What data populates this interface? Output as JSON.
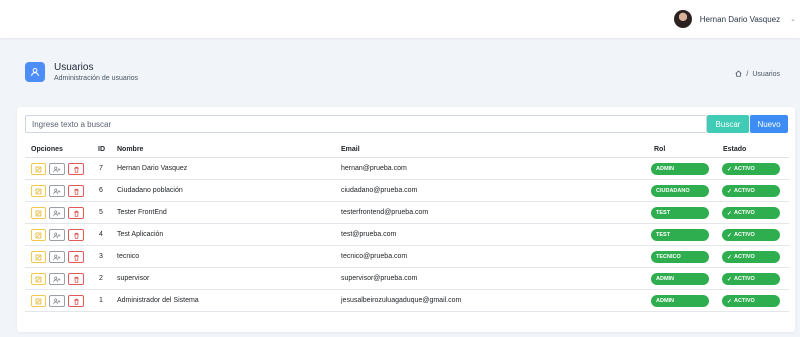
{
  "header": {
    "user_name": "Hernan Dario Vasquez",
    "caret_icon": "chevron-down-icon"
  },
  "page": {
    "title": "Usuarios",
    "subtitle": "Administración de usuarios",
    "breadcrumb_current": "Usuarios"
  },
  "toolbar": {
    "search_placeholder": "Ingrese texto a buscar",
    "search_label": "Buscar",
    "new_label": "Nuevo"
  },
  "table": {
    "columns": [
      "Opciones",
      "ID",
      "Nombre",
      "Email",
      "Rol",
      "Estado"
    ],
    "rows": [
      {
        "id": "7",
        "nombre": "Hernan Dario Vasquez",
        "email": "hernan@prueba.com",
        "rol": "ADMIN",
        "estado": "ACTIVO"
      },
      {
        "id": "6",
        "nombre": "Ciudadano población",
        "email": "ciudadano@prueba.com",
        "rol": "CIUDADANO",
        "estado": "ACTIVO"
      },
      {
        "id": "5",
        "nombre": "Tester FrontEnd",
        "email": "testerfrontend@prueba.com",
        "rol": "TEST",
        "estado": "ACTIVO"
      },
      {
        "id": "4",
        "nombre": "Test Aplicación",
        "email": "test@prueba.com",
        "rol": "TEST",
        "estado": "ACTIVO"
      },
      {
        "id": "3",
        "nombre": "tecnico",
        "email": "tecnico@prueba.com",
        "rol": "TECNICO",
        "estado": "ACTIVO"
      },
      {
        "id": "2",
        "nombre": "supervisor",
        "email": "supervisor@prueba.com",
        "rol": "ADMIN",
        "estado": "ACTIVO"
      },
      {
        "id": "1",
        "nombre": "Administrador del Sistema",
        "email": "jesusalbeirozuluagaduque@gmail.com",
        "rol": "ADMIN",
        "estado": "ACTIVO"
      }
    ]
  },
  "colors": {
    "primary": "#3d8df5",
    "info": "#3fcbb5",
    "success": "#2eae4f",
    "warning": "#f2c94c",
    "danger": "#e05a5a"
  }
}
